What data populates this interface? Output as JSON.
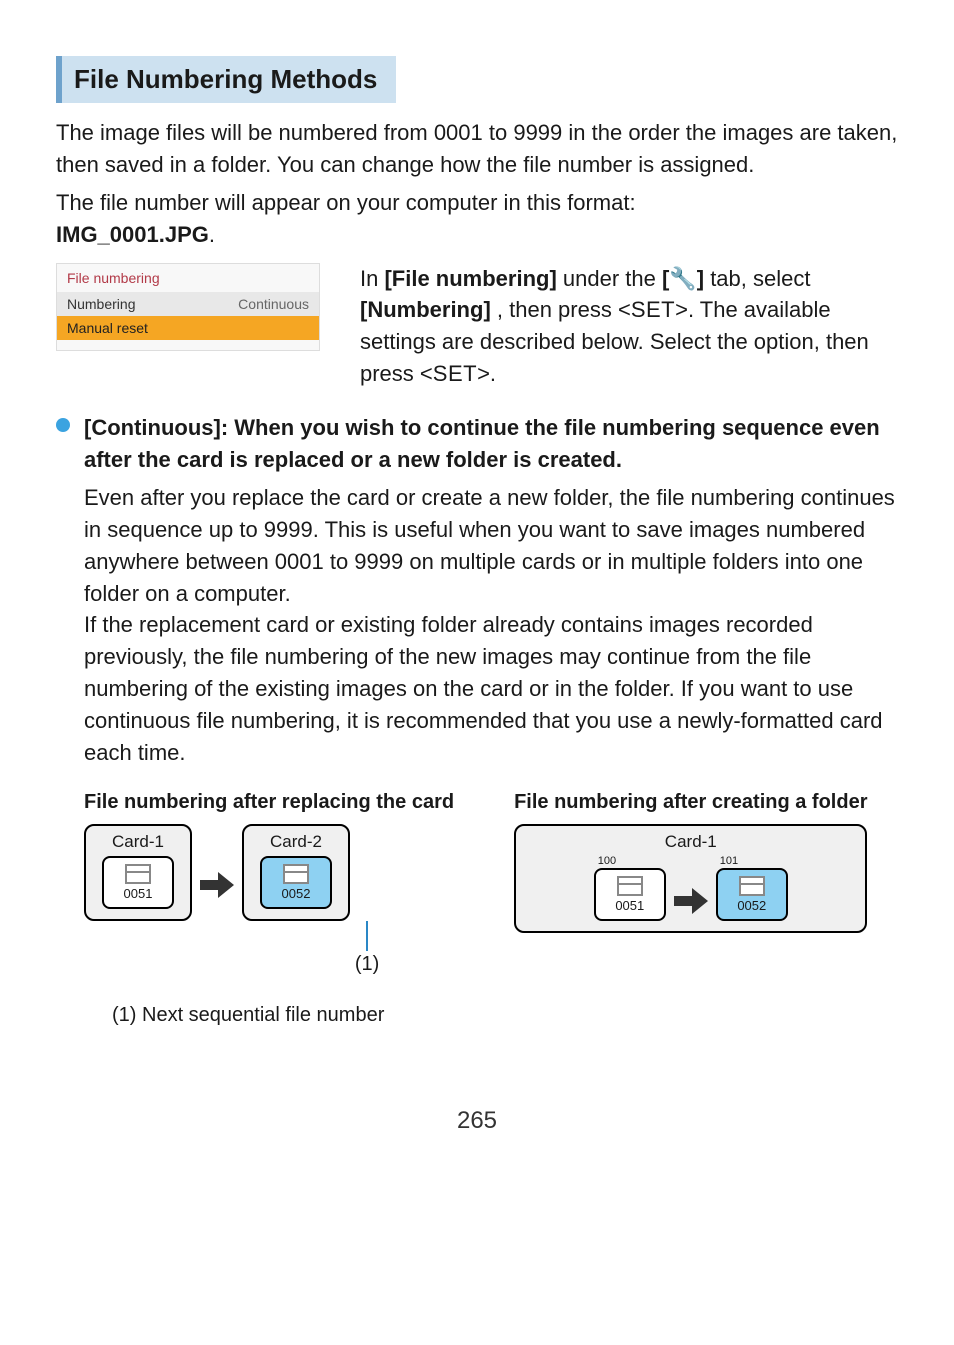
{
  "section_title": "File Numbering Methods",
  "intro": {
    "p1": "The image files will be numbered from 0001 to 9999 in the order the images are taken, then saved in a folder. You can change how the file number is assigned.",
    "p2_prefix": "The file number will appear on your computer in this format: ",
    "p2_example": "IMG_0001.JPG",
    "p2_suffix": "."
  },
  "menu": {
    "header": "File numbering",
    "row_numbering_label": "Numbering",
    "row_numbering_value": "Continuous",
    "row_reset_label": "Manual reset"
  },
  "context": {
    "line1_a": "In ",
    "line1_b": "[File numbering]",
    "line1_c": " under the ",
    "line1_d_open": "[",
    "line1_wrench": "🔧",
    "line1_d_close": "]",
    "line1_e": " tab, select ",
    "line1_f": "[Numbering]",
    "line1_g": ", then press <",
    "line1_set": "SET",
    "line1_h": ">. The available settings are described below. Select the option, then press <",
    "line1_i": ">."
  },
  "bullets": [
    {
      "title": "[Continuous]: When you wish to continue the file numbering sequence even after the card is replaced or a new folder is created.",
      "body_p1": "Even after you replace the card or create a new folder, the file numbering continues in sequence up to 9999. This is useful when you want to save images numbered anywhere between 0001 to 9999 on multiple cards or in multiple folders into one folder on a computer.",
      "body_p2": "If the replacement card or existing folder already contains images recorded previously, the file numbering of the new images may continue from the file numbering of the existing images on the card or in the folder. If you want to use continuous file numbering, it is recommended that you use a newly-formatted card each time."
    }
  ],
  "diagrams": {
    "left": {
      "title": "File numbering after replacing  the card",
      "card1_label": "Card-1",
      "card1_num": "0051",
      "card2_label": "Card-2",
      "card2_num": "0052",
      "callout_label": "(1)"
    },
    "right": {
      "title": "File numbering after creating a folder",
      "card_label": "Card-1",
      "folder1": "100",
      "folder1_num": "0051",
      "folder2": "101",
      "folder2_num": "0052"
    }
  },
  "legend": "(1) Next sequential file number",
  "page_number": "265"
}
